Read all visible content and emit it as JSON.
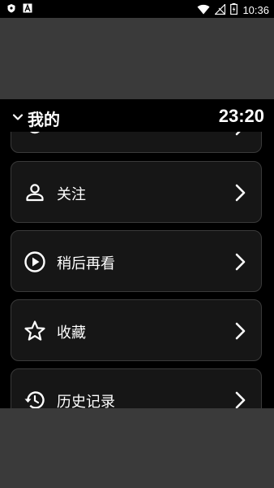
{
  "status_bar": {
    "time": "10:36",
    "icons": [
      "shield-icon",
      "font-a-icon",
      "wifi-icon",
      "no-signal-icon",
      "battery-charging-icon"
    ]
  },
  "header": {
    "title": "我的",
    "clock": "23:20",
    "back_icon": "chevron-down-icon"
  },
  "items": [
    {
      "label": "",
      "icon": "partial-item-icon"
    },
    {
      "label": "关注",
      "icon": "person-icon"
    },
    {
      "label": "稍后再看",
      "icon": "play-circle-icon"
    },
    {
      "label": "收藏",
      "icon": "star-icon"
    },
    {
      "label": "历史记录",
      "icon": "history-icon"
    }
  ],
  "colors": {
    "background": "#000000",
    "card": "#161616",
    "card_border": "#3a3a3a",
    "text": "#ffffff",
    "outside": "#3a3a3a"
  }
}
